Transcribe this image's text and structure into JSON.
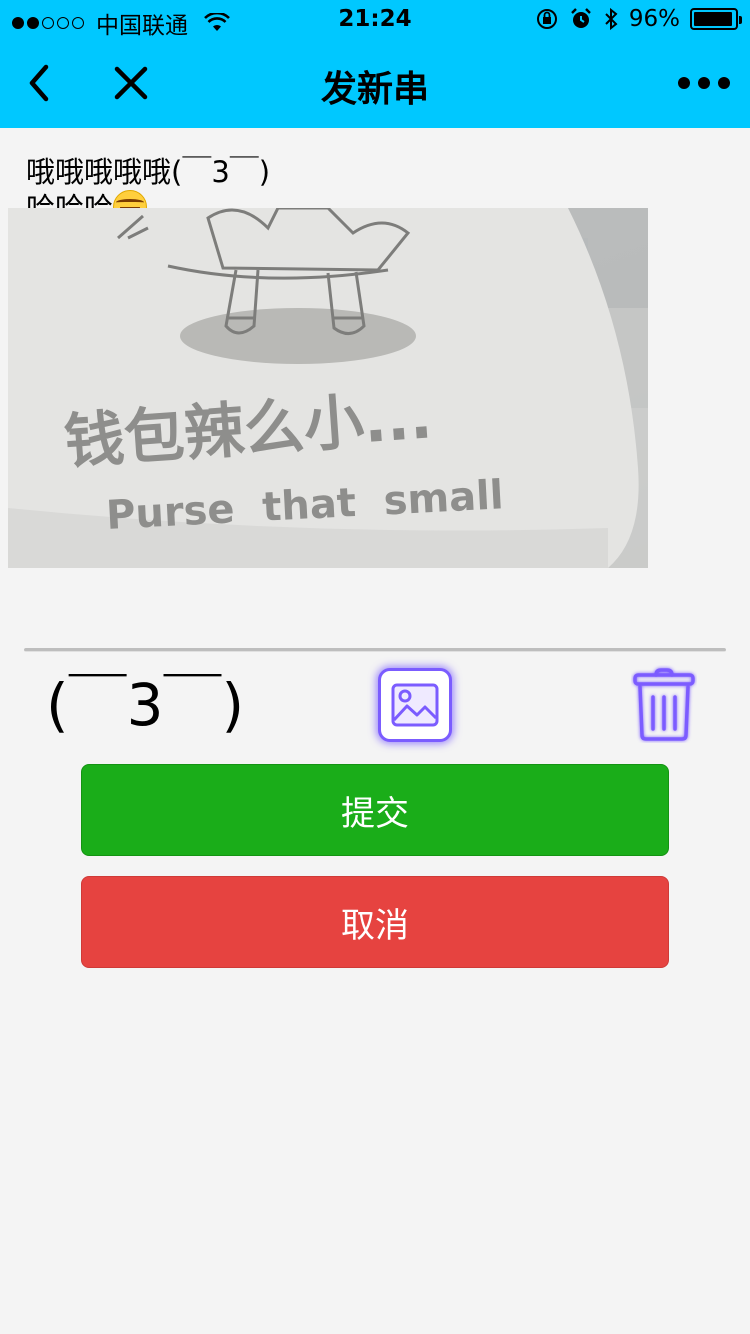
{
  "status_bar": {
    "carrier": "中国联通",
    "time": "21:24",
    "battery_percent": "96%",
    "battery_level": 0.96,
    "signal_bars": [
      true,
      true,
      false,
      false,
      false
    ],
    "icons": [
      "wifi-icon",
      "rotation-lock-icon",
      "alarm-icon",
      "bluetooth-icon",
      "battery-icon"
    ]
  },
  "nav": {
    "title": "发新串",
    "back_icon": "chevron-left-icon",
    "close_icon": "close-icon",
    "more_icon": "more-icon"
  },
  "post": {
    "text_line1": "哦哦哦哦哦(￣3￣)",
    "text_line2": "哈哈哈",
    "emoji": "tears-of-joy-emoji",
    "image_caption_cn": "钱包辣么小...",
    "image_caption_en": "Purse  that  small"
  },
  "toolbar": {
    "kaomoji": "(￣3￣)",
    "image_icon": "image-icon",
    "trash_icon": "trash-icon"
  },
  "buttons": {
    "submit": "提交",
    "cancel": "取消"
  },
  "colors": {
    "header": "#00c8ff",
    "submit": "#1aad19",
    "cancel": "#e64340",
    "icon_accent": "#7b5cff",
    "background": "#f4f4f4"
  }
}
